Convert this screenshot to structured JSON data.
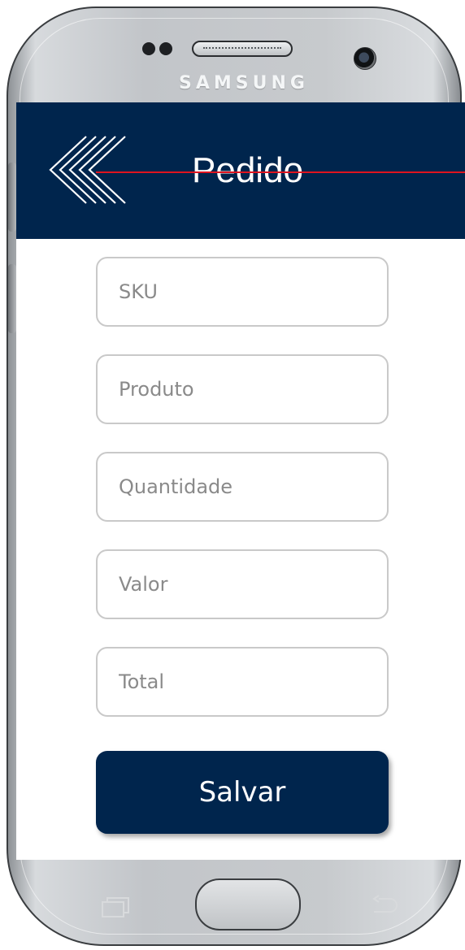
{
  "device": {
    "brand": "SAMSUNG"
  },
  "header": {
    "title": "Pedido",
    "back_icon": "double-chevron-left-icon",
    "background_color": "#00254d"
  },
  "form": {
    "fields": [
      {
        "placeholder": "SKU"
      },
      {
        "placeholder": "Produto"
      },
      {
        "placeholder": "Quantidade"
      },
      {
        "placeholder": "Valor"
      },
      {
        "placeholder": "Total"
      }
    ],
    "save_label": "Salvar"
  },
  "colors": {
    "primary": "#00254d",
    "annotation_line": "#e0141f"
  }
}
